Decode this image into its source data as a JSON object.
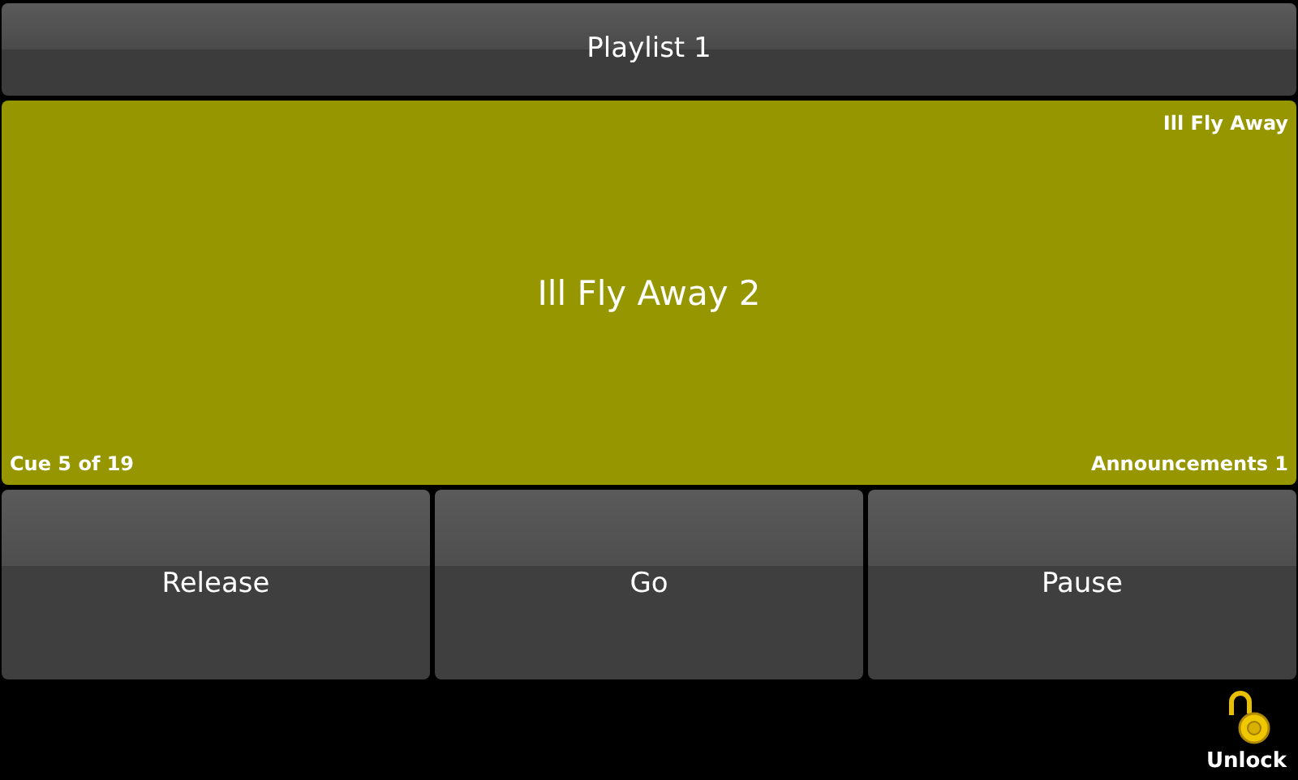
{
  "header": {
    "title": "Playlist 1"
  },
  "cue": {
    "name": "Ill Fly Away 2",
    "next": "Ill Fly Away",
    "position": "Cue 5 of 19",
    "list": "Announcements 1",
    "color": "#969600"
  },
  "buttons": [
    {
      "label": "Release"
    },
    {
      "label": "Go"
    },
    {
      "label": "Pause"
    }
  ],
  "lock": {
    "label": "Unlock",
    "locked": false
  }
}
